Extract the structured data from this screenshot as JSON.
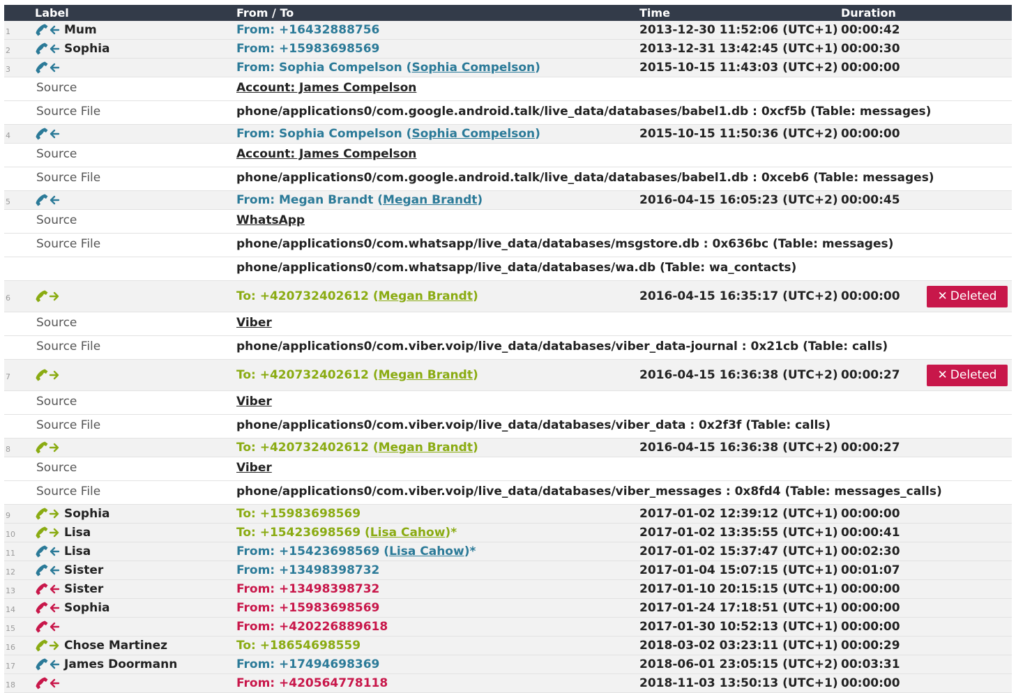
{
  "header": {
    "label": "Label",
    "from_to": "From / To",
    "time": "Time",
    "duration": "Duration"
  },
  "colors": {
    "incoming": "#2b7a98",
    "outgoing": "#8aab12",
    "missed": "#c8174a",
    "header_bg": "#333b49",
    "deleted_badge": "#c8174a"
  },
  "deleted_label": "Deleted",
  "rows": [
    {
      "n": "1",
      "dir": "in",
      "color": "blue",
      "label": "Mum",
      "ft": "From: +16432888756",
      "time": "2013-12-30 11:52:06 (UTC+1)",
      "dur": "00:00:42"
    },
    {
      "n": "2",
      "dir": "in",
      "color": "blue",
      "label": "Sophia",
      "ft": "From: +15983698569",
      "time": "2013-12-31 13:42:45 (UTC+1)",
      "dur": "00:00:30"
    },
    {
      "n": "3",
      "dir": "in",
      "color": "blue",
      "label": "",
      "ft": "From: Sophia Compelson ",
      "link": "Sophia Compelson",
      "time": "2015-10-15 11:43:03 (UTC+2)",
      "dur": "00:00:00",
      "details": [
        {
          "k": "Source",
          "v": "Account: James Compelson",
          "u": true
        },
        {
          "k": "Source File",
          "v": "phone/applications0/com.google.android.talk/live_data/databases/babel1.db : 0xcf5b (Table: messages)"
        }
      ]
    },
    {
      "n": "4",
      "dir": "in",
      "color": "blue",
      "label": "",
      "ft": "From: Sophia Compelson ",
      "link": "Sophia Compelson",
      "time": "2015-10-15 11:50:36 (UTC+2)",
      "dur": "00:00:00",
      "details": [
        {
          "k": "Source",
          "v": "Account: James Compelson",
          "u": true
        },
        {
          "k": "Source File",
          "v": "phone/applications0/com.google.android.talk/live_data/databases/babel1.db : 0xceb6 (Table: messages)"
        }
      ]
    },
    {
      "n": "5",
      "dir": "in",
      "color": "blue",
      "label": "",
      "ft": "From: Megan Brandt ",
      "link": "Megan Brandt",
      "time": "2016-04-15 16:05:23 (UTC+2)",
      "dur": "00:00:45",
      "details": [
        {
          "k": "Source",
          "v": "WhatsApp",
          "u": true
        },
        {
          "k": "Source File",
          "v": "phone/applications0/com.whatsapp/live_data/databases/msgstore.db : 0x636bc (Table: messages)"
        },
        {
          "k": "",
          "v": "phone/applications0/com.whatsapp/live_data/databases/wa.db (Table: wa_contacts)"
        }
      ]
    },
    {
      "n": "6",
      "dir": "out",
      "color": "green",
      "label": "",
      "ft": "To: +420732402612 ",
      "link": "Megan Brandt",
      "time": "2016-04-15 16:35:17 (UTC+2)",
      "dur": "00:00:00",
      "deleted": true,
      "details": [
        {
          "k": "Source",
          "v": "Viber",
          "u": true
        },
        {
          "k": "Source File",
          "v": "phone/applications0/com.viber.voip/live_data/databases/viber_data-journal : 0x21cb (Table: calls)"
        }
      ]
    },
    {
      "n": "7",
      "dir": "out",
      "color": "green",
      "label": "",
      "ft": "To: +420732402612 ",
      "link": "Megan Brandt",
      "time": "2016-04-15 16:36:38 (UTC+2)",
      "dur": "00:00:27",
      "deleted": true,
      "details": [
        {
          "k": "Source",
          "v": "Viber",
          "u": true
        },
        {
          "k": "Source File",
          "v": "phone/applications0/com.viber.voip/live_data/databases/viber_data : 0x2f3f (Table: calls)"
        }
      ]
    },
    {
      "n": "8",
      "dir": "out",
      "color": "green",
      "label": "",
      "ft": "To: +420732402612 ",
      "link": "Megan Brandt",
      "time": "2016-04-15 16:36:38 (UTC+2)",
      "dur": "00:00:27",
      "details": [
        {
          "k": "Source",
          "v": "Viber",
          "u": true
        },
        {
          "k": "Source File",
          "v": "phone/applications0/com.viber.voip/live_data/databases/viber_messages : 0x8fd4 (Table: messages_calls)"
        }
      ]
    },
    {
      "n": "9",
      "dir": "out",
      "color": "green",
      "label": "Sophia",
      "ft": "To: +15983698569",
      "time": "2017-01-02 12:39:12 (UTC+1)",
      "dur": "00:00:00"
    },
    {
      "n": "10",
      "dir": "out",
      "color": "green",
      "label": "Lisa",
      "ft": "To: +15423698569 ",
      "link": "Lisa Cahow",
      "star": "*",
      "time": "2017-01-02 13:35:55 (UTC+1)",
      "dur": "00:00:41"
    },
    {
      "n": "11",
      "dir": "in",
      "color": "blue",
      "label": "Lisa",
      "ft": "From: +15423698569 ",
      "link": "Lisa Cahow",
      "star": "*",
      "time": "2017-01-02 15:37:47 (UTC+1)",
      "dur": "00:02:30"
    },
    {
      "n": "12",
      "dir": "in",
      "color": "blue",
      "label": "Sister",
      "ft": "From: +13498398732",
      "time": "2017-01-04 15:07:15 (UTC+1)",
      "dur": "00:01:07"
    },
    {
      "n": "13",
      "dir": "in",
      "color": "red",
      "label": "Sister",
      "ft": "From: +13498398732",
      "time": "2017-01-10 20:15:15 (UTC+1)",
      "dur": "00:00:00"
    },
    {
      "n": "14",
      "dir": "in",
      "color": "red",
      "label": "Sophia",
      "ft": "From: +15983698569",
      "time": "2017-01-24 17:18:51 (UTC+1)",
      "dur": "00:00:00"
    },
    {
      "n": "15",
      "dir": "in",
      "color": "red",
      "label": "",
      "ft": "From: +420226889618",
      "time": "2017-01-30 10:52:13 (UTC+1)",
      "dur": "00:00:00"
    },
    {
      "n": "16",
      "dir": "out",
      "color": "green",
      "label": "Chose Martinez",
      "ft": "To: +18654698559",
      "time": "2018-03-02 03:23:11 (UTC+1)",
      "dur": "00:00:29"
    },
    {
      "n": "17",
      "dir": "in",
      "color": "blue",
      "label": "James Doormann",
      "ft": "From: +17494698369",
      "time": "2018-06-01 23:05:15 (UTC+2)",
      "dur": "00:03:31"
    },
    {
      "n": "18",
      "dir": "in",
      "color": "red",
      "label": "",
      "ft": "From: +420564778118",
      "time": "2018-11-03 13:50:13 (UTC+1)",
      "dur": "00:00:00"
    }
  ]
}
